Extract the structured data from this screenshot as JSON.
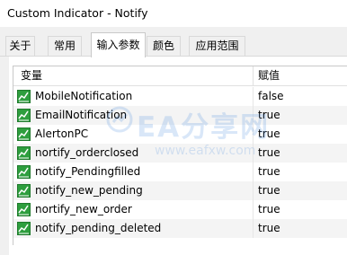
{
  "window": {
    "title": "Custom Indicator - Notify"
  },
  "tabs": [
    {
      "label": "关于",
      "active": false
    },
    {
      "label": "常用",
      "active": false
    },
    {
      "label": "输入参数",
      "active": true
    },
    {
      "label": "颜色",
      "active": false
    },
    {
      "label": "应用范围",
      "active": false
    }
  ],
  "table": {
    "headers": {
      "variable": "变量",
      "value": "赋值"
    },
    "rows": [
      {
        "name": "MobileNotification",
        "value": "false"
      },
      {
        "name": "EmailNotification",
        "value": "true"
      },
      {
        "name": "AlertonPC",
        "value": "true"
      },
      {
        "name": "nortify_orderclosed",
        "value": "true"
      },
      {
        "name": "notify_Pendingfilled",
        "value": "true"
      },
      {
        "name": "notify_new_pending",
        "value": "true"
      },
      {
        "name": "nortify_new_order",
        "value": "true"
      },
      {
        "name": "notify_pending_deleted",
        "value": "true"
      }
    ],
    "row_icon": "boolean-parameter-icon",
    "icon_color": "#2e9e3e"
  },
  "watermark": {
    "brand": "EA分享网",
    "url": "www.eafxw.com"
  }
}
